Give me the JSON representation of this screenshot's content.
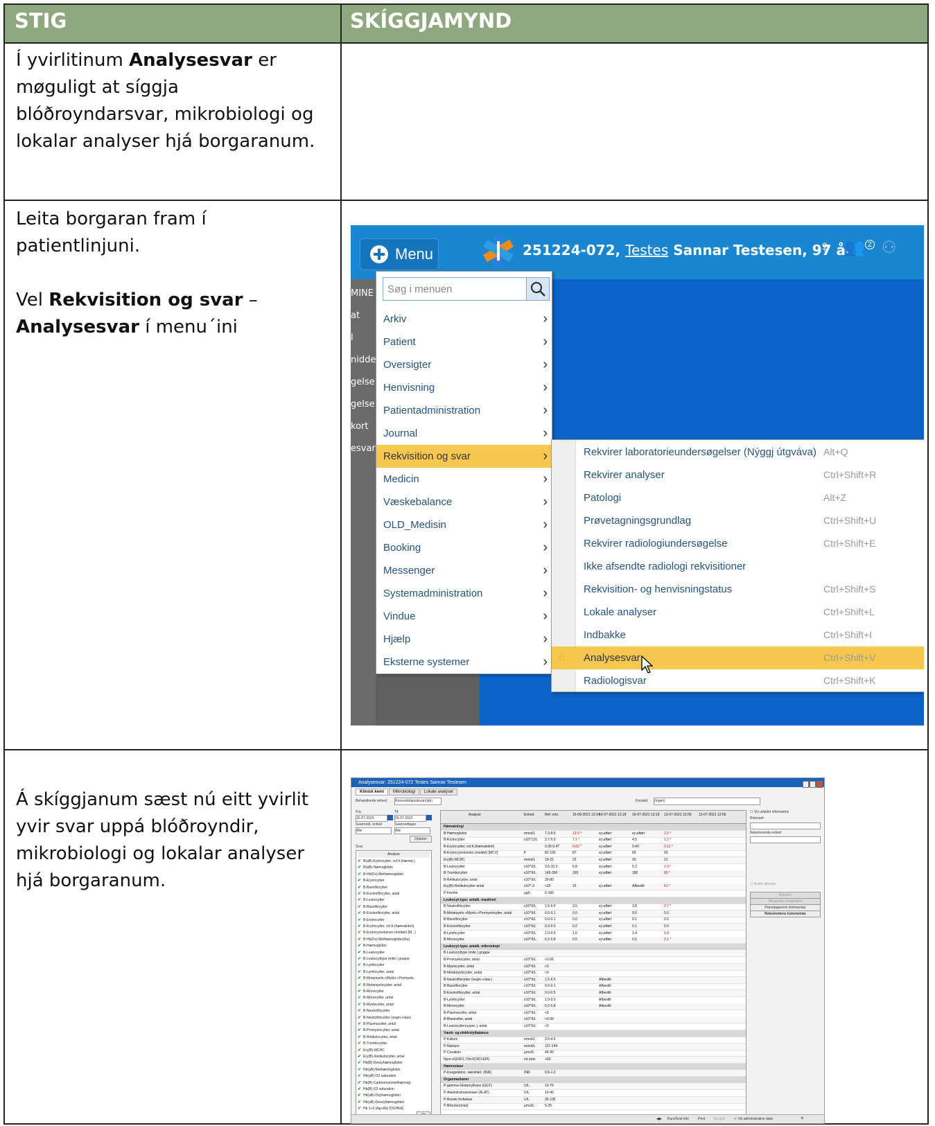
{
  "header": {
    "col1": "STIG",
    "col2": "SKÍGGJAMYND"
  },
  "rows": [
    {
      "parts": [
        {
          "text": "Í yvirlitinum ",
          "bold": false
        },
        {
          "text": "Analysesvar",
          "bold": true
        },
        {
          "text": " er møguligt at síggja blóðroyndarsvar, mikrobiologi og lokalar analyser hjá borgaranum.",
          "bold": false
        }
      ]
    },
    {
      "para1": "Leita borgaran fram í patientlinjuni.",
      "para2_parts": [
        {
          "text": "Vel ",
          "bold": false
        },
        {
          "text": "Rekvisition og svar",
          "bold": true
        },
        {
          "text": " – ",
          "bold": false
        },
        {
          "text": "Analysesvar",
          "bold": true
        },
        {
          "text": " í menu´ini",
          "bold": false
        }
      ]
    },
    {
      "text": "Á skíggjanum sæst nú eitt yvirlit yvir svar uppá blóðroyndir, mikrobiologi og lokalar analyser hjá borgaranum."
    }
  ],
  "screenshot1": {
    "menu_label": "Menu",
    "patient_id": "251224-072,",
    "patient_first": "Testes",
    "patient_rest": "Sannar Testesen, 97 år",
    "badge_count": "2",
    "left_labels": [
      "MINE",
      "at",
      "l",
      "nidde",
      "gelse",
      "gelse",
      "kort",
      "esvar"
    ],
    "search_placeholder": "Søg i menuen",
    "menu_items": [
      "Arkiv",
      "Patient",
      "Oversigter",
      "Henvisning",
      "Patientadministration",
      "Journal",
      "Rekvisition og svar",
      "Medicin",
      "Væskebalance",
      "OLD_Medisin",
      "Booking",
      "Messenger",
      "Systemadministration",
      "Vindue",
      "Hjælp",
      "Eksterne systemer"
    ],
    "selected_menu": "Rekvisition og svar",
    "sub_items": [
      {
        "label": "Rekvirer laboratorieundersøgelser (Nýggj útgváva)",
        "shortcut": "Alt+Q"
      },
      {
        "label": "Rekvirer analyser",
        "shortcut": "Ctrl+Shift+R"
      },
      {
        "label": "Patologi",
        "shortcut": "Alt+Z"
      },
      {
        "label": "Prøvetagningsgrundlag",
        "shortcut": "Ctrl+Shift+U"
      },
      {
        "label": "Rekvirer radiologiundersøgelse",
        "shortcut": "Ctrl+Shift+E"
      },
      {
        "label": "Ikke afsendte radiologi rekvisitioner",
        "shortcut": ""
      },
      {
        "label": "Rekvisition- og henvisningstatus",
        "shortcut": "Ctrl+Shift+S"
      },
      {
        "label": "Lokale analyser",
        "shortcut": "Ctrl+Shift+L"
      },
      {
        "label": "Indbakke",
        "shortcut": "Ctrl+Shift+I"
      },
      {
        "label": "Analysesvar",
        "shortcut": "Ctrl+Shift+V"
      },
      {
        "label": "Radiologisvar",
        "shortcut": "Ctrl+Shift+K"
      }
    ],
    "selected_sub": "Analysesvar"
  },
  "screenshot2": {
    "title": "Analysesvar: 251224-072 Testes Sannar Testesen",
    "tabs": [
      "Klinisk kemi",
      "Mikrobiologi",
      "Lokale analyser"
    ],
    "behandlende_label": "Behandlende enhed:",
    "behandlende_value": "Ronesitalrapsitexan(lab)",
    "kontakt_label": "Kontakt:",
    "kontakt_value": "(Ingen)",
    "fra_label": "Fra:",
    "fra_value": "15-07-2020",
    "til_label": "Til:",
    "til_value": "05-07-2022",
    "svarmodt_label": "Svarmodt. enhed",
    "svarmodt_value": "Alle",
    "svarmodtager_label": "Svarmodtager",
    "svarmodtager_value": "Alle",
    "opdater": "Opdater",
    "svar_label": "Svar",
    "analyse_header": "Analyse",
    "vis": "Vis",
    "left_list": [
      "B(aB)-Erytrocytter, vol.fr.(hæmat.)",
      "B(aB)-Hæmoglobin",
      "B-Hb(Fe)-Methæmoglobin",
      "B-Erytrocytter",
      "B-Basofilocytter",
      "B-Eosinofilocytter, antal",
      "B-Leukocytter",
      "B-Basofilocytter",
      "B-Eosinofilocytter, antal",
      "B-Erytrocytter",
      "B-Erytrocytter, vol.fr.(hæmatokrit)",
      "B-Erytrocytvolumen (middel) [M...]",
      "B-Hb(Fe)-Methæmoglobin(Fe)",
      "B-Hæmoglobin",
      "B-Leukocytter",
      "B-Leukocyttype (mikr.) gruppe",
      "B-Lymfocytter",
      "B-Lymfocytter, antal",
      "B-Metamyelo.+Myelo.+Promyelo.",
      "B-Metamyelocytter, antal",
      "B-Monocytter",
      "B-Monocytter, antal",
      "B-Myelocytter, antal",
      "B-Neutrofilocytter",
      "B-Neutrofilocytter (segm.+stav)",
      "B-Plasmaceller, antal",
      "B-Promyelocytter, antal",
      "B-Retikulocytter, antal",
      "B-Trombocytter",
      "Ery(B)-MCHC",
      "Ery(B)-Retikulocytter, antal",
      "Hb(B)-Deoxyhæmoglobin",
      "Hb(aB)-Methæmoglobin",
      "Hb(aB)-O2 saturation",
      "Hb(B)-Carbonmonoxidhæmogl.",
      "Hb(B)-O2 saturation",
      "Hb(aB)-Oxyhæmoglobin",
      "Hb(aB)-Deoxyhæmoglobin",
      "Hb 1+2 (Ag+Ab) (DUHKA)"
    ],
    "grid_headers": [
      "Analyse",
      "Enhed",
      "Ref. omr.",
      "15-09-2021 13:14",
      "16-07-2021 13:18",
      "16-07-2021 13:18",
      "13-07-2021 12:06",
      "13-07-2021 12:06"
    ],
    "grid_rows": [
      {
        "sec": true,
        "name": "Hæmatologi"
      },
      {
        "name": "B-Hæmoglobin",
        "unit": "mmol/L",
        "ref": "7.3-9.5",
        "v1": "13.5 *",
        "v2": "ej udført",
        "v3": "ej udført",
        "v4": "2.2 *"
      },
      {
        "name": "B-Erytrocytter",
        "unit": "x10^12/L",
        "ref": "3.7-5.0",
        "v1": "7.1 *",
        "v2": "ej udført",
        "v3": "4.5",
        "v4": "1.2 *"
      },
      {
        "name": "B-Erytrocytter, vol.fr.(hæmatokrit)",
        "unit": "",
        "ref": "0.35-0.47",
        "v1": "0.62 *",
        "v2": "ej udført",
        "v3": "0.40",
        "v4": "0.11 *"
      },
      {
        "name": "B-Erytrocytvolumen (middel) [MCV]",
        "unit": "fl",
        "ref": "82-100",
        "v1": "87",
        "v2": "ej udført",
        "v3": "89",
        "v4": "90"
      },
      {
        "name": "Ery(B)-MCHC",
        "unit": "mmol/L",
        "ref": "19-22",
        "v1": "22",
        "v2": "ej udført",
        "v3": "20",
        "v4": "21"
      },
      {
        "name": "B-Leukocytter",
        "unit": "x10^9/L",
        "ref": "3.5-10.0",
        "v1": "5.8",
        "v2": "ej udført",
        "v3": "5.3",
        "v4": "1.9 *"
      },
      {
        "name": "B-Trombocytter",
        "unit": "x10^9/L",
        "ref": "145-390",
        "v1": "165",
        "v2": "ej udført",
        "v3": "180",
        "v4": "80 *"
      },
      {
        "name": "B-Retikulocytter, antal",
        "unit": "x10^9/L",
        "ref": "20-80",
        "v1": "",
        "v2": "",
        "v3": "",
        "v4": ""
      },
      {
        "name": "Ery(B)-Retikulocytter antal",
        "unit": "x10^-3",
        "ref": "<20",
        "v1": "15",
        "v2": "ej udført",
        "v3": "Afbestilt",
        "v4": "61 *"
      },
      {
        "name": "P-Ferritin",
        "unit": "µg/L",
        "ref": "6-180",
        "v1": "",
        "v2": "",
        "v3": "",
        "v4": ""
      },
      {
        "sec": true,
        "name": "Leukocyt-type; antalk. maskinel"
      },
      {
        "name": "B-Neutrofilocytter",
        "unit": "x10^9/L",
        "ref": "1.5-5.5",
        "v1": "3.5",
        "v2": "ej udført",
        "v3": "3.8",
        "v4": "0.7 *"
      },
      {
        "name": "B-Metamyelo.+Myelo.+Promyelocytter, antal",
        "unit": "x10^9/L",
        "ref": "0.0-0.1",
        "v1": "0.0",
        "v2": "ej udført",
        "v3": "0.0",
        "v4": "0.0"
      },
      {
        "name": "B-Basofilocytter",
        "unit": "x10^9/L",
        "ref": "0.0-0.1",
        "v1": "0.0",
        "v2": "ej udført",
        "v3": "0.1",
        "v4": "0.0"
      },
      {
        "name": "B-Eosinofilocytter",
        "unit": "x10^9/L",
        "ref": "0.0-0.5",
        "v1": "0.2",
        "v2": "ej udført",
        "v3": "0.1",
        "v4": "0.0"
      },
      {
        "name": "B-Lymfocytter",
        "unit": "x10^9/L",
        "ref": "1.0-3.5",
        "v1": "1.6",
        "v2": "ej udført",
        "v3": "1.4",
        "v4": "1.0"
      },
      {
        "name": "B-Monocytter",
        "unit": "x10^9/L",
        "ref": "0.2-0.8",
        "v1": "0.5",
        "v2": "ej udført",
        "v3": "0.5",
        "v4": "0.1 *"
      },
      {
        "sec": true,
        "name": "Leukocyt-type; antalk. mikroskopi"
      },
      {
        "name": "B-Leukocyttype (mikr.) gruppe",
        "unit": "",
        "ref": "",
        "v1": "",
        "v2": "",
        "v3": "",
        "v4": ""
      },
      {
        "name": "B-Promyelocytter, antal",
        "unit": "x10^9/L",
        "ref": "<0.06",
        "v1": "",
        "v2": "",
        "v3": "",
        "v4": ""
      },
      {
        "name": "B-Myelocytter, antal",
        "unit": "x10^9/L",
        "ref": "<0",
        "v1": "",
        "v2": "",
        "v3": "",
        "v4": ""
      },
      {
        "name": "B-Metamyelocytter, antal",
        "unit": "x10^9/L",
        "ref": "<0",
        "v1": "",
        "v2": "",
        "v3": "",
        "v4": ""
      },
      {
        "name": "B-Neutrofilocytter (segm.+stav.)",
        "unit": "x10^9/L",
        "ref": "1.5-5.5",
        "v1": "",
        "v2": "Afbestilt",
        "v3": "",
        "v4": ""
      },
      {
        "name": "B-Basofilocytter",
        "unit": "x10^9/L",
        "ref": "0.0-0.1",
        "v1": "",
        "v2": "Afbestilt",
        "v3": "",
        "v4": ""
      },
      {
        "name": "B-Eosinofilocytter, antal",
        "unit": "x10^9/L",
        "ref": "0.0-0.5",
        "v1": "",
        "v2": "Afbestilt",
        "v3": "",
        "v4": ""
      },
      {
        "name": "B-Lymfocytter",
        "unit": "x10^9/L",
        "ref": "1.0-3.5",
        "v1": "",
        "v2": "Afbestilt",
        "v3": "",
        "v4": ""
      },
      {
        "name": "B-Monocytter",
        "unit": "x10^9/L",
        "ref": "0.2-0.8",
        "v1": "",
        "v2": "Afbestilt",
        "v3": "",
        "v4": ""
      },
      {
        "name": "B-Plasmaceller, antal",
        "unit": "x10^9/L",
        "ref": "<0",
        "v1": "",
        "v2": "",
        "v3": "",
        "v4": ""
      },
      {
        "name": "B-Blastceller, antal",
        "unit": "x10^9/L",
        "ref": "<0.00",
        "v1": "",
        "v2": "",
        "v3": "",
        "v4": ""
      },
      {
        "name": "B-Leukocytter(uspec.), antal",
        "unit": "x10^9/L",
        "ref": "<0",
        "v1": "",
        "v2": "",
        "v3": "",
        "v4": ""
      },
      {
        "sec": true,
        "name": "Væsk- og elektrolytbalance"
      },
      {
        "name": "P-Kalium",
        "unit": "mmol/L",
        "ref": "3.5-4.6",
        "v1": "",
        "v2": "",
        "v3": "",
        "v4": ""
      },
      {
        "name": "P-Natrium",
        "unit": "mmol/L",
        "ref": "137-144",
        "v1": "",
        "v2": "",
        "v3": "",
        "v4": ""
      },
      {
        "name": "P-Creatinin",
        "unit": "µmol/L",
        "ref": "45-90",
        "v1": "",
        "v2": "",
        "v3": "",
        "v4": ""
      },
      {
        "name": "Nyre-eGFR/1.73m²(CKD-EPI)",
        "unit": "mL/min",
        "ref": ">60",
        "v1": "",
        "v2": "",
        "v3": "",
        "v4": ""
      },
      {
        "sec": true,
        "name": "Hæmostase"
      },
      {
        "name": "P-Koagulation, vævsfakt. (INR)",
        "unit": "INR",
        "ref": "0.8-1.2",
        "v1": "",
        "v2": "",
        "v3": "",
        "v4": ""
      },
      {
        "sec": true,
        "name": "Organmarkører"
      },
      {
        "name": "P-gamma-Glutamyltrans (GGT)",
        "unit": "U/L",
        "ref": "10-75",
        "v1": "",
        "v2": "",
        "v3": "",
        "v4": ""
      },
      {
        "name": "P-Alanintransaminase (ALAT)",
        "unit": "U/L",
        "ref": "10-45",
        "v1": "",
        "v2": "",
        "v3": "",
        "v4": ""
      },
      {
        "name": "P-Basisk fosfatase",
        "unit": "U/L",
        "ref": "35-105",
        "v1": "",
        "v2": "",
        "v3": "",
        "v4": ""
      },
      {
        "name": "P-Bilirubin(total)",
        "unit": "µmol/L",
        "ref": "5-25",
        "v1": "",
        "v2": "",
        "v3": "",
        "v4": ""
      }
    ],
    "right": {
      "vis_admin": "Vis udvidet information",
      "relevant": "Relevant",
      "rekvirerende": "Rekvirerende enhed",
      "andre": "Andre allergier",
      "btn1": "Rekvirer",
      "btn2": "Tilbagelæs ekspedient",
      "btn3": "Prøvetagerens kommentar",
      "btn4": "Rekvirentens kommentar"
    },
    "bottom": {
      "b1": "Kurv/Graf info",
      "b2": "Print",
      "b3": "Vis graf",
      "b4": "Vis administrative data"
    },
    "alert_color": "#d20000"
  }
}
